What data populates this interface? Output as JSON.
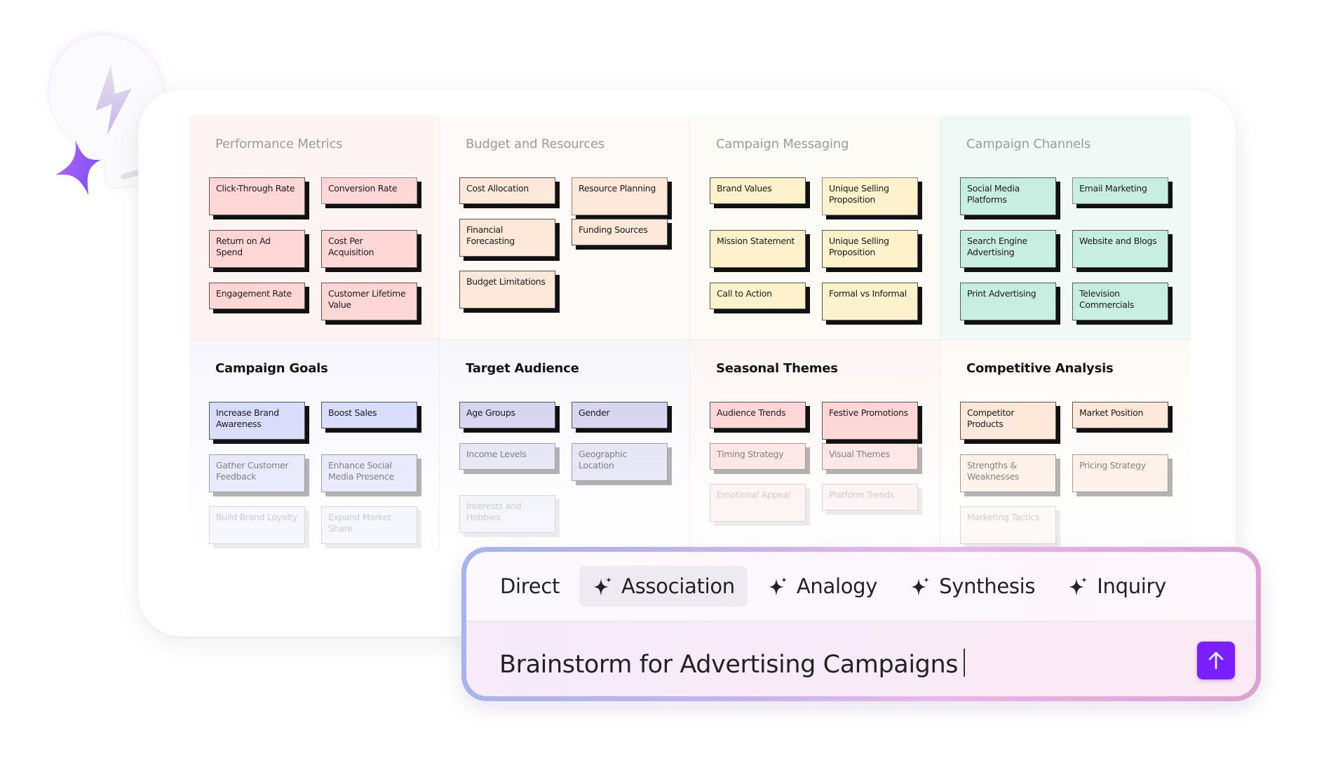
{
  "logo": {
    "name": "lightbulb-spark-logo"
  },
  "categories": [
    {
      "title": "Performance Metrics",
      "bg": "#fdf4f3",
      "note_color": "#ffd6d5",
      "notes": [
        {
          "label": "Click-Through Rate"
        },
        {
          "label": "Conversion Rate"
        },
        {
          "label": "Return on Ad Spend"
        },
        {
          "label": "Cost Per Acquisition"
        },
        {
          "label": "Engagement Rate"
        },
        {
          "label": "Customer Lifetime Value"
        }
      ]
    },
    {
      "title": "Budget and Resources",
      "bg": "#fdfaf7",
      "note_color": "#fde7d8",
      "notes": [
        {
          "label": "Cost Allocation"
        },
        {
          "label": "Resource Planning"
        },
        {
          "label": "Financial Forecasting"
        },
        {
          "label": "Funding Sources"
        },
        {
          "label": "Budget Limitations"
        }
      ]
    },
    {
      "title": "Campaign Messaging",
      "bg": "#fcfbf5",
      "note_color": "#fdf2ca",
      "notes": [
        {
          "label": "Brand Values"
        },
        {
          "label": "Unique Selling Proposition"
        },
        {
          "label": "Mission Statement"
        },
        {
          "label": "Unique Selling Proposition"
        },
        {
          "label": "Call to Action"
        },
        {
          "label": "Formal vs Informal"
        }
      ]
    },
    {
      "title": "Campaign Channels",
      "bg": "#f1f9f6",
      "note_color": "#c6eee0",
      "notes": [
        {
          "label": "Social Media Platforms"
        },
        {
          "label": "Email Marketing"
        },
        {
          "label": "Search Engine Advertising"
        },
        {
          "label": "Website and Blogs"
        },
        {
          "label": "Print Advertising"
        },
        {
          "label": "Television Commercials"
        }
      ]
    },
    {
      "title": "Campaign Goals",
      "bg": "#f6f6fd",
      "note_color": "#d8dcfb",
      "notes": [
        {
          "label": "Increase Brand Awareness"
        },
        {
          "label": "Boost Sales"
        },
        {
          "label": "Gather Customer Feedback"
        },
        {
          "label": "Enhance Social Media Presence"
        },
        {
          "label": "Build Brand Loyalty"
        },
        {
          "label": "Expand Market Share"
        }
      ]
    },
    {
      "title": "Target Audience",
      "bg": "#f7f7fb",
      "note_color": "#d6d5f0",
      "notes": [
        {
          "label": "Age Groups"
        },
        {
          "label": "Gender"
        },
        {
          "label": "Income Levels"
        },
        {
          "label": "Geographic Location"
        },
        {
          "label": "Interests and Hobbies"
        }
      ]
    },
    {
      "title": "Seasonal Themes",
      "bg": "#fdf5f4",
      "note_color": "#ffd6d5",
      "notes": [
        {
          "label": "Audience Trends"
        },
        {
          "label": "Festive Promotions"
        },
        {
          "label": "Timing Strategy"
        },
        {
          "label": "Visual Themes"
        },
        {
          "label": "Emotional Appeal"
        },
        {
          "label": "Platform Trends"
        }
      ]
    },
    {
      "title": "Competitive Analysis",
      "bg": "#fdfaf6",
      "note_color": "#fde7d8",
      "notes": [
        {
          "label": "Competitor Products"
        },
        {
          "label": "Market Position"
        },
        {
          "label": "Strengths & Weaknesses"
        },
        {
          "label": "Pricing Strategy"
        },
        {
          "label": "Marketing Tactics"
        }
      ]
    }
  ],
  "prompt": {
    "modes": [
      {
        "label": "Direct",
        "icon": "",
        "active": false
      },
      {
        "label": "Association",
        "icon": "sparkle-icon",
        "active": true
      },
      {
        "label": "Analogy",
        "icon": "sparkle-icon",
        "active": false
      },
      {
        "label": "Synthesis",
        "icon": "sparkle-icon",
        "active": false
      },
      {
        "label": "Inquiry",
        "icon": "sparkle-icon",
        "active": false
      }
    ],
    "input_value": "Brainstorm for Advertising Campaigns",
    "send_icon": "arrow-up-icon",
    "accent": "#7b1fff"
  }
}
